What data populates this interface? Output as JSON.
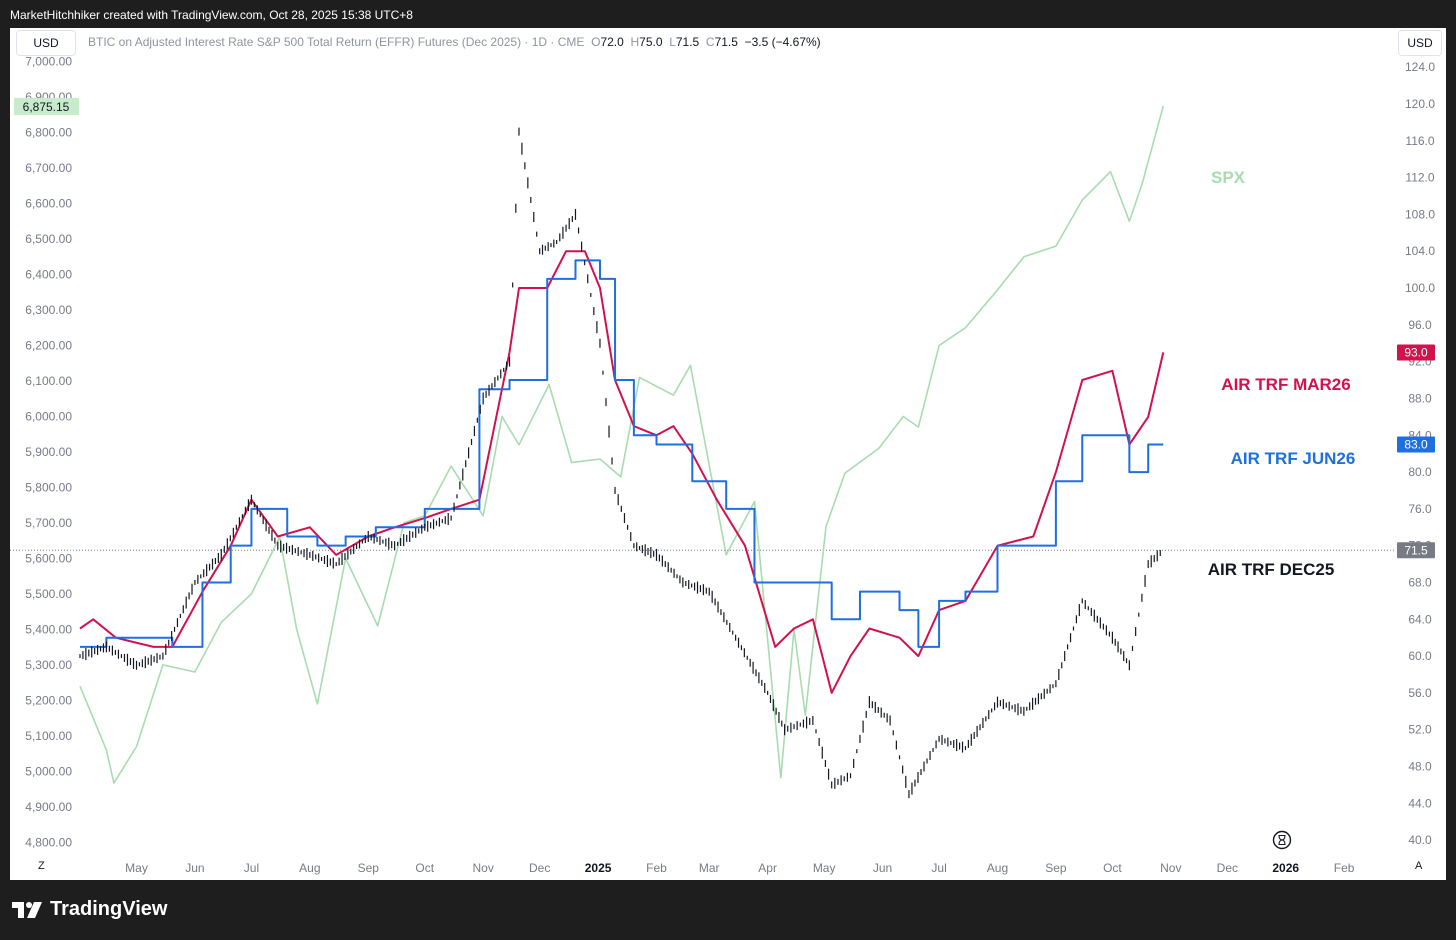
{
  "header": {
    "credit": "MarketHitchhiker created with TradingView.com, Oct 28, 2025 15:38 UTC+8"
  },
  "toolbar": {
    "left_currency": "USD",
    "right_currency": "USD"
  },
  "instrument": {
    "name": "BTIC on Adjusted Interest Rate S&P 500 Total Return (EFFR) Futures (Dec 2025) · 1D · CME",
    "o_label": "O",
    "o_value": "72.0",
    "h_label": "H",
    "h_value": "75.0",
    "l_label": "L",
    "l_value": "71.5",
    "c_label": "C",
    "c_value": "71.5",
    "change": "−3.5 (−4.67%)"
  },
  "footer": {
    "brand": "TradingView",
    "left_button": "Z",
    "right_button": "A"
  },
  "colors": {
    "spx": "#a8dcb0",
    "mar26": "#d1124d",
    "jun26": "#1e6fe0",
    "dec25": "#131722",
    "spx_tag_bg": "#c9ebcd",
    "mar26_tag_bg": "#d1124d",
    "jun26_tag_bg": "#1e6fe0",
    "dec25_tag_bg": "#787b86"
  },
  "chart_data": {
    "type": "line",
    "left_axis": {
      "ticks": [
        "7,000.00",
        "6,900.00",
        "6,800.00",
        "6,700.00",
        "6,600.00",
        "6,500.00",
        "6,400.00",
        "6,300.00",
        "6,200.00",
        "6,100.00",
        "6,000.00",
        "5,900.00",
        "5,800.00",
        "5,700.00",
        "5,600.00",
        "5,500.00",
        "5,400.00",
        "5,300.00",
        "5,200.00",
        "5,100.00",
        "5,000.00",
        "4,900.00",
        "4,800.00"
      ],
      "ylim": [
        4770,
        7010
      ],
      "current_label": "6,875.15"
    },
    "right_axis": {
      "ticks": [
        "124.0",
        "120.0",
        "116.0",
        "112.0",
        "108.0",
        "104.0",
        "100.0",
        "96.0",
        "92.0",
        "88.0",
        "84.0",
        "80.0",
        "76.0",
        "72.0",
        "68.0",
        "64.0",
        "60.0",
        "56.0",
        "52.0",
        "48.0",
        "44.0",
        "40.0"
      ],
      "ylim": [
        38.6,
        125.0
      ],
      "current_labels": [
        {
          "series": "AIR TRF MAR26",
          "text": "93.0",
          "value": 93.0
        },
        {
          "series": "AIR TRF JUN26",
          "text": "83.0",
          "value": 83.0
        },
        {
          "series": "AIR TRF DEC25",
          "text": "71.5",
          "value": 71.5
        }
      ]
    },
    "x_axis": {
      "ticks": [
        "May",
        "Jun",
        "Jul",
        "Aug",
        "Sep",
        "Oct",
        "Nov",
        "Dec",
        "2025",
        "Feb",
        "Mar",
        "Apr",
        "May",
        "Jun",
        "Jul",
        "Aug",
        "Sep",
        "Oct",
        "Nov",
        "Dec",
        "2026",
        "Feb"
      ],
      "bold_ticks": [
        "2025",
        "2026"
      ],
      "range": [
        "2024-04-01",
        "2026-02-28"
      ]
    },
    "series": [
      {
        "name": "SPX",
        "axis": "left",
        "points": [
          [
            "2024-04-01",
            5240
          ],
          [
            "2024-04-15",
            5060
          ],
          [
            "2024-04-19",
            4967
          ],
          [
            "2024-05-01",
            5070
          ],
          [
            "2024-05-15",
            5300
          ],
          [
            "2024-06-01",
            5280
          ],
          [
            "2024-06-15",
            5420
          ],
          [
            "2024-07-01",
            5500
          ],
          [
            "2024-07-16",
            5660
          ],
          [
            "2024-07-25",
            5400
          ],
          [
            "2024-08-05",
            5190
          ],
          [
            "2024-08-20",
            5600
          ],
          [
            "2024-09-06",
            5410
          ],
          [
            "2024-09-20",
            5700
          ],
          [
            "2024-10-01",
            5720
          ],
          [
            "2024-10-15",
            5860
          ],
          [
            "2024-11-01",
            5720
          ],
          [
            "2024-11-11",
            6000
          ],
          [
            "2024-11-20",
            5920
          ],
          [
            "2024-12-06",
            6090
          ],
          [
            "2024-12-18",
            5870
          ],
          [
            "2025-01-02",
            5880
          ],
          [
            "2025-01-13",
            5830
          ],
          [
            "2025-01-23",
            6110
          ],
          [
            "2025-02-10",
            6060
          ],
          [
            "2025-02-19",
            6144
          ],
          [
            "2025-03-10",
            5610
          ],
          [
            "2025-03-25",
            5760
          ],
          [
            "2025-04-08",
            4982
          ],
          [
            "2025-04-15",
            5400
          ],
          [
            "2025-04-21",
            5158
          ],
          [
            "2025-05-02",
            5690
          ],
          [
            "2025-05-12",
            5840
          ],
          [
            "2025-05-30",
            5910
          ],
          [
            "2025-06-12",
            6000
          ],
          [
            "2025-06-20",
            5970
          ],
          [
            "2025-07-01",
            6200
          ],
          [
            "2025-07-15",
            6250
          ],
          [
            "2025-07-31",
            6350
          ],
          [
            "2025-08-15",
            6450
          ],
          [
            "2025-09-01",
            6480
          ],
          [
            "2025-09-15",
            6610
          ],
          [
            "2025-09-30",
            6690
          ],
          [
            "2025-10-10",
            6550
          ],
          [
            "2025-10-17",
            6660
          ],
          [
            "2025-10-28",
            6875
          ]
        ]
      },
      {
        "name": "AIR TRF MAR26",
        "axis": "right",
        "points": [
          [
            "2024-04-01",
            63
          ],
          [
            "2024-04-08",
            64
          ],
          [
            "2024-04-20",
            62
          ],
          [
            "2024-05-10",
            61
          ],
          [
            "2024-05-20",
            61
          ],
          [
            "2024-06-05",
            67
          ],
          [
            "2024-06-20",
            72
          ],
          [
            "2024-07-01",
            77
          ],
          [
            "2024-07-15",
            73
          ],
          [
            "2024-08-01",
            74
          ],
          [
            "2024-08-15",
            71
          ],
          [
            "2024-09-01",
            73
          ],
          [
            "2024-09-15",
            74
          ],
          [
            "2024-10-01",
            75
          ],
          [
            "2024-10-15",
            76
          ],
          [
            "2024-10-30",
            77
          ],
          [
            "2024-11-15",
            93
          ],
          [
            "2024-11-20",
            100
          ],
          [
            "2024-12-05",
            100
          ],
          [
            "2024-12-15",
            104
          ],
          [
            "2024-12-25",
            104
          ],
          [
            "2025-01-02",
            100
          ],
          [
            "2025-01-10",
            90
          ],
          [
            "2025-01-20",
            85
          ],
          [
            "2025-02-01",
            84
          ],
          [
            "2025-02-10",
            85
          ],
          [
            "2025-02-20",
            82
          ],
          [
            "2025-03-05",
            77
          ],
          [
            "2025-03-20",
            72
          ],
          [
            "2025-04-05",
            61
          ],
          [
            "2025-04-15",
            63
          ],
          [
            "2025-04-25",
            64
          ],
          [
            "2025-05-05",
            56
          ],
          [
            "2025-05-15",
            60
          ],
          [
            "2025-05-25",
            63
          ],
          [
            "2025-06-10",
            62
          ],
          [
            "2025-06-20",
            60
          ],
          [
            "2025-07-01",
            65
          ],
          [
            "2025-07-15",
            66
          ],
          [
            "2025-08-01",
            72
          ],
          [
            "2025-08-20",
            73
          ],
          [
            "2025-09-01",
            80
          ],
          [
            "2025-09-15",
            90
          ],
          [
            "2025-10-01",
            91
          ],
          [
            "2025-10-10",
            83
          ],
          [
            "2025-10-20",
            86
          ],
          [
            "2025-10-28",
            93
          ]
        ]
      },
      {
        "name": "AIR TRF JUN26",
        "axis": "right",
        "points": [
          [
            "2024-04-01",
            61
          ],
          [
            "2024-04-15",
            62
          ],
          [
            "2024-05-01",
            62
          ],
          [
            "2024-05-20",
            61
          ],
          [
            "2024-06-05",
            68
          ],
          [
            "2024-06-20",
            72
          ],
          [
            "2024-07-01",
            76
          ],
          [
            "2024-07-20",
            73
          ],
          [
            "2024-08-05",
            72
          ],
          [
            "2024-08-20",
            73
          ],
          [
            "2024-09-05",
            74
          ],
          [
            "2024-09-20",
            74
          ],
          [
            "2024-10-01",
            76
          ],
          [
            "2024-10-15",
            76
          ],
          [
            "2024-10-30",
            89
          ],
          [
            "2024-11-15",
            90
          ],
          [
            "2024-11-25",
            90
          ],
          [
            "2024-12-05",
            101
          ],
          [
            "2024-12-20",
            103
          ],
          [
            "2025-01-02",
            101
          ],
          [
            "2025-01-10",
            90
          ],
          [
            "2025-01-20",
            84
          ],
          [
            "2025-02-01",
            83
          ],
          [
            "2025-02-20",
            79
          ],
          [
            "2025-03-10",
            76
          ],
          [
            "2025-03-25",
            68
          ],
          [
            "2025-04-10",
            68
          ],
          [
            "2025-04-25",
            68
          ],
          [
            "2025-05-05",
            64
          ],
          [
            "2025-05-20",
            67
          ],
          [
            "2025-06-10",
            65
          ],
          [
            "2025-06-20",
            61
          ],
          [
            "2025-07-01",
            66
          ],
          [
            "2025-07-15",
            67
          ],
          [
            "2025-08-01",
            72
          ],
          [
            "2025-08-20",
            72
          ],
          [
            "2025-09-01",
            79
          ],
          [
            "2025-09-15",
            84
          ],
          [
            "2025-10-01",
            84
          ],
          [
            "2025-10-10",
            80
          ],
          [
            "2025-10-20",
            83
          ],
          [
            "2025-10-28",
            83
          ]
        ]
      },
      {
        "name": "AIR TRF DEC25",
        "axis": "right",
        "style": "ohlc",
        "points": [
          [
            "2024-04-01",
            60
          ],
          [
            "2024-04-15",
            61
          ],
          [
            "2024-05-01",
            59
          ],
          [
            "2024-05-15",
            60
          ],
          [
            "2024-06-01",
            68
          ],
          [
            "2024-06-15",
            71
          ],
          [
            "2024-07-01",
            77
          ],
          [
            "2024-07-15",
            72
          ],
          [
            "2024-08-01",
            71
          ],
          [
            "2024-08-15",
            70
          ],
          [
            "2024-09-01",
            73
          ],
          [
            "2024-09-15",
            72
          ],
          [
            "2024-10-01",
            74
          ],
          [
            "2024-10-15",
            75
          ],
          [
            "2024-11-01",
            88
          ],
          [
            "2024-11-15",
            92
          ],
          [
            "2024-11-20",
            117
          ],
          [
            "2024-12-01",
            104
          ],
          [
            "2024-12-10",
            105
          ],
          [
            "2024-12-20",
            108
          ],
          [
            "2025-01-02",
            94
          ],
          [
            "2025-01-10",
            78
          ],
          [
            "2025-01-20",
            72
          ],
          [
            "2025-02-01",
            71
          ],
          [
            "2025-02-15",
            68
          ],
          [
            "2025-03-01",
            67
          ],
          [
            "2025-03-15",
            62
          ],
          [
            "2025-04-01",
            56
          ],
          [
            "2025-04-10",
            52
          ],
          [
            "2025-04-25",
            53
          ],
          [
            "2025-05-05",
            46
          ],
          [
            "2025-05-15",
            47
          ],
          [
            "2025-05-25",
            55
          ],
          [
            "2025-06-05",
            53
          ],
          [
            "2025-06-15",
            45
          ],
          [
            "2025-07-01",
            51
          ],
          [
            "2025-07-15",
            50
          ],
          [
            "2025-08-01",
            55
          ],
          [
            "2025-08-15",
            54
          ],
          [
            "2025-09-01",
            57
          ],
          [
            "2025-09-15",
            66
          ],
          [
            "2025-10-01",
            62
          ],
          [
            "2025-10-10",
            59
          ],
          [
            "2025-10-20",
            70
          ],
          [
            "2025-10-28",
            71.5
          ]
        ]
      }
    ],
    "annotations": [
      {
        "text": "SPX",
        "series": "SPX"
      },
      {
        "text": "AIR TRF MAR26",
        "series": "AIR TRF MAR26"
      },
      {
        "text": "AIR TRF JUN26",
        "series": "AIR TRF JUN26"
      },
      {
        "text": "AIR TRF DEC25",
        "series": "AIR TRF DEC25"
      }
    ],
    "reference_line": {
      "axis": "right",
      "value": 71.5,
      "style": "dotted"
    }
  }
}
